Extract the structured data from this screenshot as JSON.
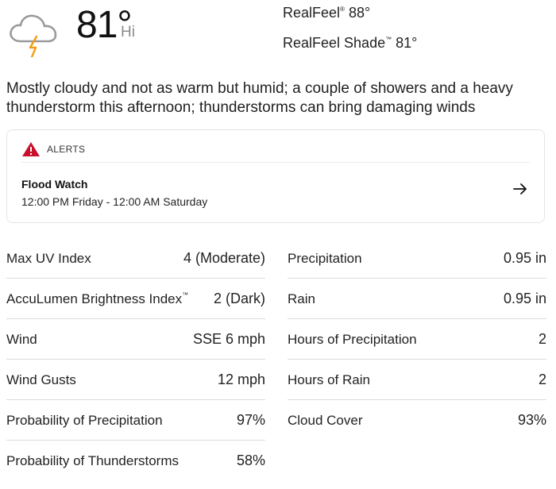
{
  "current": {
    "icon": "thunderstorm-cloud-icon",
    "temperature": "81°",
    "temperature_label": "Hi",
    "realfeel_label": "RealFeel",
    "realfeel_value": "88°",
    "realfeel_shade_label": "RealFeel Shade",
    "realfeel_shade_value": "81°",
    "trademark": "®",
    "tm": "™"
  },
  "phrase": "Mostly cloudy and not as warm but humid; a couple of showers and a heavy thunderstorm this afternoon; thunderstorms can bring damaging winds",
  "alerts": {
    "title": "ALERTS",
    "icon": "warning-triangle-icon",
    "icon_color": "#c8102e",
    "items": [
      {
        "name": "Flood Watch",
        "time": "12:00 PM Friday - 12:00 AM Saturday",
        "icon": "arrow-right-icon"
      }
    ]
  },
  "details": {
    "left": [
      {
        "label": "Max UV Index",
        "value": "4 (Moderate)"
      },
      {
        "label": "AccuLumen Brightness Index",
        "label_sup": "™",
        "value": "2 (Dark)"
      },
      {
        "label": "Wind",
        "value": "SSE 6 mph"
      },
      {
        "label": "Wind Gusts",
        "value": "12 mph"
      },
      {
        "label": "Probability of Precipitation",
        "value": "97%"
      },
      {
        "label": "Probability of Thunderstorms",
        "value": "58%"
      }
    ],
    "right": [
      {
        "label": "Precipitation",
        "value": "0.95 in"
      },
      {
        "label": "Rain",
        "value": "0.95 in"
      },
      {
        "label": "Hours of Precipitation",
        "value": "2"
      },
      {
        "label": "Hours of Rain",
        "value": "2"
      },
      {
        "label": "Cloud Cover",
        "value": "93%"
      }
    ]
  }
}
